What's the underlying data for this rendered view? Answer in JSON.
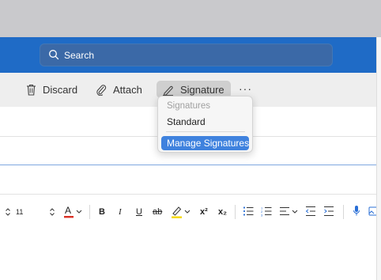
{
  "search": {
    "label": "Search"
  },
  "toolbar": {
    "discard_label": "Discard",
    "attach_label": "Attach",
    "signature_label": "Signature",
    "more_label": "···"
  },
  "signature_menu": {
    "header": "Signatures",
    "items": [
      "Standard"
    ],
    "manage_label": "Manage Signatures"
  },
  "format": {
    "font_size": "11",
    "superscript": "x²",
    "subscript": "x₂",
    "bold": "B",
    "italic": "I",
    "underline": "U",
    "strike": "ab"
  },
  "colors": {
    "accent": "#1f6bc6",
    "highlight": "#3f82de",
    "font_color": "#d93025",
    "highlighter": "#f5d800"
  }
}
